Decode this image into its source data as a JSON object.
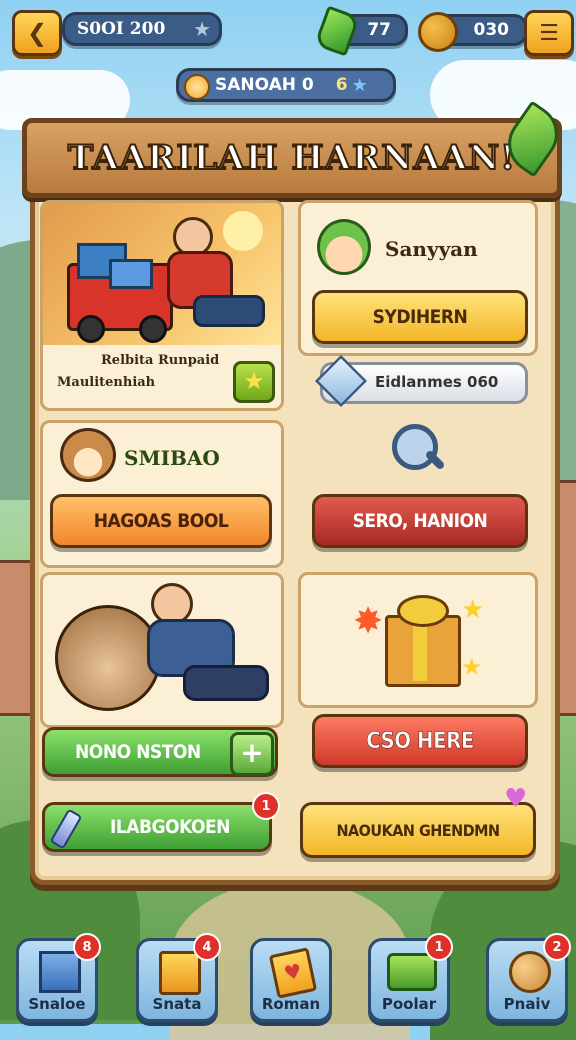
{
  "top_bar": {
    "back_icon": "chevron-left-icon",
    "player_score": "S0OI 200",
    "gems": "77",
    "coins": "030",
    "menu_icon": "hamburger-icon"
  },
  "subtitle_pill": {
    "label": "SANOAH 0",
    "count": "6"
  },
  "board": {
    "title": "TAARILAH HARNAAN!",
    "card1": {
      "line1": "Relbita Runpaid",
      "line2": "Maulitenhiah"
    },
    "card2": {
      "name": "Sanyyan",
      "button": "SYDIHERN",
      "progress_label": "Eidlanmes 060"
    },
    "card3": {
      "name": "SMIBAO",
      "button": "HAGOAS BOOL"
    },
    "card4": {
      "button": "SERO, HANION"
    },
    "card5": {
      "button": "NONO NSTON",
      "plus": "+"
    },
    "card6": {
      "button": "CSO HERE"
    },
    "bottom_left": {
      "button": "ILABGOKOEN",
      "badge": "1"
    },
    "bottom_right": {
      "button": "NAOUKAN GHENDMN"
    }
  },
  "nav": [
    {
      "label": "Snaloe",
      "badge": "8"
    },
    {
      "label": "Snata",
      "badge": "4"
    },
    {
      "label": "Roman",
      "badge": ""
    },
    {
      "label": "Poolar",
      "badge": "1"
    },
    {
      "label": "Pnaiv",
      "badge": "2"
    }
  ]
}
